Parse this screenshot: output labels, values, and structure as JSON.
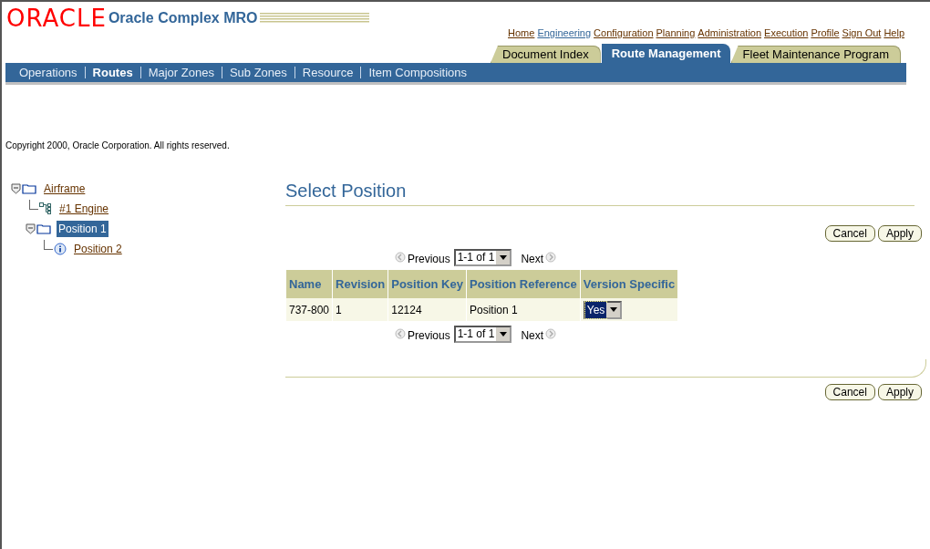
{
  "header": {
    "logo": "ORACLE",
    "app_title": "Oracle Complex MRO"
  },
  "global_links": [
    {
      "label": "Home",
      "selected": false
    },
    {
      "label": "Engineering",
      "selected": true
    },
    {
      "label": "Configuration",
      "selected": false
    },
    {
      "label": "Planning",
      "selected": false
    },
    {
      "label": "Administration",
      "selected": false
    },
    {
      "label": "Execution",
      "selected": false
    },
    {
      "label": "Profile",
      "selected": false
    },
    {
      "label": "Sign Out",
      "selected": false
    },
    {
      "label": "Help",
      "selected": false
    }
  ],
  "tabs": [
    {
      "label": "Document Index",
      "selected": false
    },
    {
      "label": "Route Management",
      "selected": true
    },
    {
      "label": "Fleet Maintenance Program",
      "selected": false
    }
  ],
  "subtabs": [
    {
      "label": "Operations",
      "selected": false
    },
    {
      "label": "Routes",
      "selected": true
    },
    {
      "label": "Major Zones",
      "selected": false
    },
    {
      "label": "Sub Zones",
      "selected": false
    },
    {
      "label": "Resource",
      "selected": false
    },
    {
      "label": "Item Compositions",
      "selected": false
    }
  ],
  "copyright": "Copyright 2000, Oracle Corporation. All rights reserved.",
  "tree": [
    {
      "label": "Airframe",
      "kind": "folder",
      "selected": false,
      "expanded": true,
      "children": [
        {
          "label": "#1 Engine",
          "kind": "structure",
          "selected": false
        },
        {
          "label": "Position 1",
          "kind": "folder",
          "selected": true,
          "expanded": true,
          "children": [
            {
              "label": "Position 2",
              "kind": "info",
              "selected": false
            }
          ]
        }
      ]
    }
  ],
  "page_title": "Select Position",
  "buttons": [
    "Cancel",
    "Apply"
  ],
  "pager": {
    "previous": "Previous",
    "range": "1-1 of 1",
    "next": "Next"
  },
  "table": {
    "columns": [
      "Name",
      "Revision",
      "Position Key",
      "Position Reference",
      "Version Specific"
    ],
    "rows": [
      {
        "cells": [
          "737-800",
          "1",
          "12124",
          "Position 1"
        ],
        "version_specific": "Yes"
      }
    ]
  },
  "pager_bottom": {
    "previous": "Previous",
    "range": "1-1 of 1",
    "next": "Next"
  },
  "buttons_bottom": [
    "Cancel",
    "Apply"
  ]
}
